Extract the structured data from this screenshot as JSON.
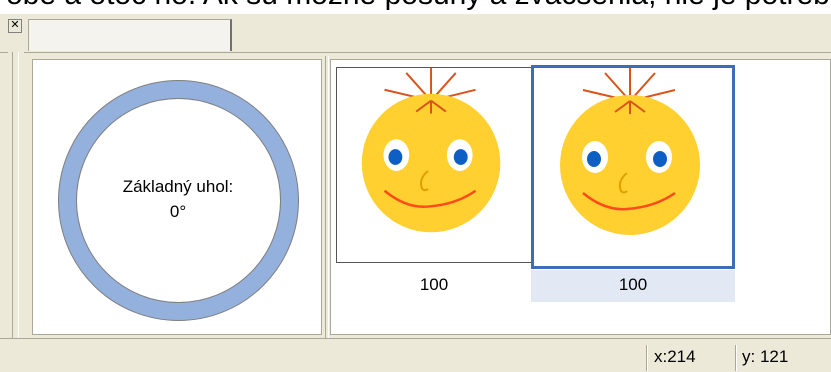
{
  "window": {
    "top_strip_text": "obe a otoč ho. Ak sú možné posuny a zväčšenia, nie je potrebné ich upravovať",
    "close_button_glyph": "✕",
    "close_button_label": "Close"
  },
  "left_panel": {
    "angle_label_line1": "Základný uhol:",
    "angle_label_line2": "0°",
    "ring_color": "#94b0dc",
    "ring_border_color": "#7f7f7f"
  },
  "right_panel": {
    "thumbnails": [
      {
        "caption": "100",
        "selected": false,
        "icon": "smiley-face-icon"
      },
      {
        "caption": "100",
        "selected": true,
        "icon": "smiley-face-icon"
      }
    ],
    "selection_color": "#3d6cb8",
    "selection_caption_bg": "#e3e8f5"
  },
  "statusbar": {
    "x_label": "x:214",
    "y_label": "y: 121"
  },
  "colors": {
    "chrome": "#ece9d8",
    "face": "#ffd030",
    "eye_white": "#ffffff",
    "eye_blue": "#0d5fc4",
    "mouth": "#ff4a1a",
    "hair": "#d8541a",
    "nose": "#e0a100"
  }
}
